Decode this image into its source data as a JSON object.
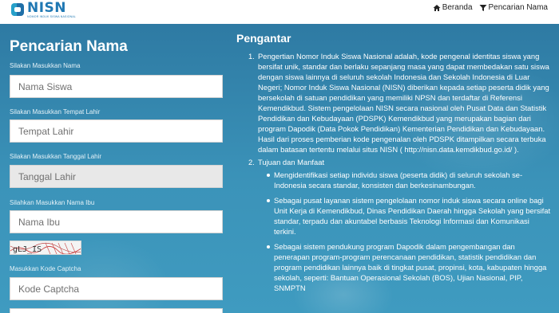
{
  "header": {
    "logo_text": "NISN",
    "logo_subtitle": "NOMOR INDUK SISWA NASIONAL",
    "nav": [
      {
        "label": "Beranda",
        "icon": "home-icon"
      },
      {
        "label": "Pencarian Nama",
        "icon": "filter-icon"
      }
    ]
  },
  "form": {
    "title": "Pencarian Nama",
    "fields": [
      {
        "label": "Silakan Masukkan Nama",
        "placeholder": "Nama Siswa",
        "disabled": false
      },
      {
        "label": "Silakan Masukkan Tempat Lahir",
        "placeholder": "Tempat Lahir",
        "disabled": false
      },
      {
        "label": "Silakan Masukkan Tanggal Lahir",
        "placeholder": "Tanggal Lahir",
        "disabled": true
      },
      {
        "label": "Silahkan Masukkan Nama Ibu",
        "placeholder": "Nama Ibu",
        "disabled": false
      }
    ],
    "captcha_text": "gLJ_IS",
    "captcha_label": "Masukkan Kode Captcha",
    "captcha_placeholder": "Kode Captcha"
  },
  "intro": {
    "title": "Pengantar",
    "items": [
      {
        "number": "1.",
        "text": "Pengertian Nomor Induk Siswa Nasional adalah, kode pengenal identitas siswa yang bersifat unik, standar dan berlaku sepanjang masa yang dapat membedakan satu siswa dengan siswa lainnya di seluruh sekolah Indonesia dan Sekolah Indonesia di Luar Negeri; Nomor Induk Siswa Nasional (NISN) diberikan kepada setiap peserta didik yang bersekolah di satuan pendidikan yang memiliki NPSN dan terdaftar di Referensi Kemendikbud. Sistem pengelolaan NISN secara nasional oleh Pusat Data dan Statistik Pendidikan dan Kebudayaan (PDSPK) Kemendikbud yang merupakan bagian dari program Dapodik (Data Pokok Pendidikan) Kementerian Pendidikan dan Kebudayaan. Hasil dari proses pemberian kode pengenalan oleh PDSPK ditampilkan secara terbuka dalam batasan tertentu melalui situs NISN ( http://nisn.data.kemdikbud.go.id/ )."
      },
      {
        "number": "2.",
        "text": "Tujuan dan Manfaat",
        "bullets": [
          "Mengidentifikasi setiap individu siswa (peserta didik) di seluruh sekolah se-Indonesia secara standar, konsisten dan berkesinambungan.",
          "Sebagai pusat layanan sistem pengelolaan nomor induk siswa secara online bagi Unit Kerja di Kemendikbud, Dinas Pendidikan Daerah hingga Sekolah yang bersifat standar, terpadu dan akuntabel berbasis Teknologi Informasi dan Komunikasi terkini.",
          "Sebagai sistem pendukung program Dapodik dalam pengembangan dan penerapan program-program perencanaan pendidikan, statistik pendidikan dan program pendidikan lainnya baik di tingkat pusat, propinsi, kota, kabupaten hingga sekolah, seperti: Bantuan Operasional Sekolah (BOS), Ujian Nasional, PIP, SNMPTN"
        ]
      }
    ]
  }
}
